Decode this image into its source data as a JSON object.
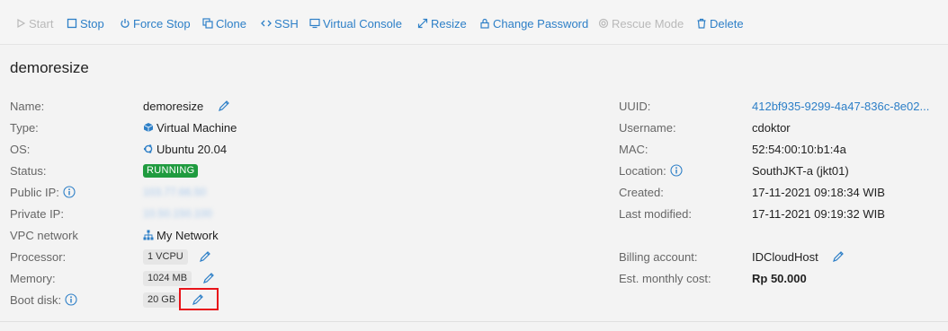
{
  "toolbar": {
    "start": "Start",
    "stop": "Stop",
    "force_stop": "Force Stop",
    "clone": "Clone",
    "ssh": "SSH",
    "virtual_console": "Virtual Console",
    "resize": "Resize",
    "change_password": "Change Password",
    "rescue_mode": "Rescue Mode",
    "delete": "Delete"
  },
  "title": "demoresize",
  "left": {
    "name_label": "Name:",
    "name_value": "demoresize",
    "type_label": "Type:",
    "type_value": "Virtual Machine",
    "os_label": "OS:",
    "os_value": "Ubuntu 20.04",
    "status_label": "Status:",
    "status_value": "RUNNING",
    "public_ip_label": "Public IP:",
    "public_ip_value": "103.77.66.50",
    "private_ip_label": "Private IP:",
    "private_ip_value": "10.50.150.100",
    "vpc_label": "VPC network",
    "vpc_value": "My Network",
    "processor_label": "Processor:",
    "processor_value": "1 VCPU",
    "memory_label": "Memory:",
    "memory_value": "1024 MB",
    "boot_disk_label": "Boot disk:",
    "boot_disk_value": "20 GB"
  },
  "right": {
    "uuid_label": "UUID:",
    "uuid_value": "412bf935-9299-4a47-836c-8e02...",
    "username_label": "Username:",
    "username_value": "cdoktor",
    "mac_label": "MAC:",
    "mac_value": "52:54:00:10:b1:4a",
    "location_label": "Location:",
    "location_value": "SouthJKT-a (jkt01)",
    "created_label": "Created:",
    "created_value": "17-11-2021 09:18:34 WIB",
    "modified_label": "Last modified:",
    "modified_value": "17-11-2021 09:19:32 WIB",
    "billing_label": "Billing account:",
    "billing_value": "IDCloudHost",
    "cost_label": "Est. monthly cost:",
    "cost_value": "Rp 50.000"
  },
  "colors": {
    "accent": "#2d7fc7",
    "running": "#1f9b3f",
    "disabled": "#b9b9b9",
    "highlight": "#e8141a"
  }
}
